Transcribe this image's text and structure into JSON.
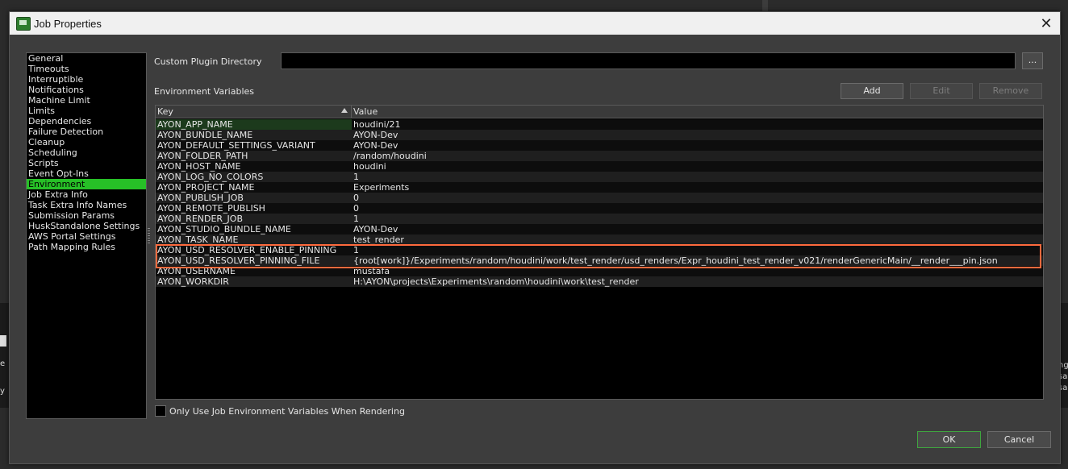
{
  "background": {
    "left_texts": [
      "e",
      "y"
    ],
    "right_texts": [
      "ng",
      "sa",
      "sa"
    ]
  },
  "window": {
    "title": "Job Properties",
    "close_glyph": "✕"
  },
  "nav": {
    "items": [
      {
        "label": "General"
      },
      {
        "label": "Timeouts"
      },
      {
        "label": "Interruptible"
      },
      {
        "label": "Notifications"
      },
      {
        "label": "Machine Limit"
      },
      {
        "label": "Limits"
      },
      {
        "label": "Dependencies"
      },
      {
        "label": "Failure Detection"
      },
      {
        "label": "Cleanup"
      },
      {
        "label": "Scheduling"
      },
      {
        "label": "Scripts"
      },
      {
        "label": "Event Opt-Ins"
      },
      {
        "label": "Environment",
        "selected": true
      },
      {
        "label": "Job Extra Info"
      },
      {
        "label": "Task Extra Info Names"
      },
      {
        "label": "Submission Params"
      },
      {
        "label": "HuskStandalone Settings"
      },
      {
        "label": "AWS Portal Settings"
      },
      {
        "label": "Path Mapping Rules"
      }
    ]
  },
  "plugin_dir": {
    "label": "Custom Plugin Directory",
    "value": "",
    "browse_label": "..."
  },
  "env": {
    "label": "Environment Variables",
    "add_label": "Add",
    "edit_label": "Edit",
    "remove_label": "Remove",
    "columns": {
      "key": "Key",
      "value": "Value"
    },
    "rows": [
      {
        "key": "AYON_APP_NAME",
        "value": "houdini/21"
      },
      {
        "key": "AYON_BUNDLE_NAME",
        "value": "AYON-Dev"
      },
      {
        "key": "AYON_DEFAULT_SETTINGS_VARIANT",
        "value": "AYON-Dev"
      },
      {
        "key": "AYON_FOLDER_PATH",
        "value": "/random/houdini"
      },
      {
        "key": "AYON_HOST_NAME",
        "value": "houdini"
      },
      {
        "key": "AYON_LOG_NO_COLORS",
        "value": "1"
      },
      {
        "key": "AYON_PROJECT_NAME",
        "value": "Experiments"
      },
      {
        "key": "AYON_PUBLISH_JOB",
        "value": "0"
      },
      {
        "key": "AYON_REMOTE_PUBLISH",
        "value": "0"
      },
      {
        "key": "AYON_RENDER_JOB",
        "value": "1"
      },
      {
        "key": "AYON_STUDIO_BUNDLE_NAME",
        "value": "AYON-Dev"
      },
      {
        "key": "AYON_TASK_NAME",
        "value": "test_render"
      },
      {
        "key": "AYON_USD_RESOLVER_ENABLE_PINNING",
        "value": "1"
      },
      {
        "key": "AYON_USD_RESOLVER_PINNING_FILE",
        "value": "{root[work]}/Experiments/random/houdini/work/test_render/usd_renders/Expr_houdini_test_render_v021/renderGenericMain/__render___pin.json"
      },
      {
        "key": "AYON_USERNAME",
        "value": "mustafa"
      },
      {
        "key": "AYON_WORKDIR",
        "value": "H:\\AYON\\projects\\Experiments\\random\\houdini\\work\\test_render"
      }
    ]
  },
  "only_job_env": {
    "label": "Only Use Job Environment Variables When Rendering",
    "checked": false
  },
  "footer": {
    "ok_label": "OK",
    "cancel_label": "Cancel"
  },
  "colors": {
    "accent": "#27c027",
    "highlight": "#ff6a3d"
  }
}
